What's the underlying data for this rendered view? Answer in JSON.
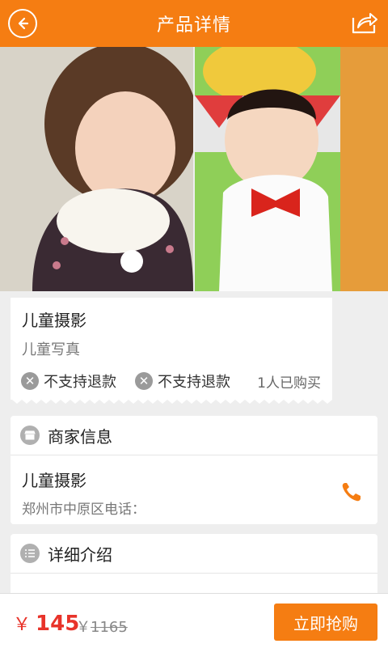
{
  "header": {
    "title": "产品详情"
  },
  "product": {
    "name": "儿童摄影",
    "subtitle": "儿童写真",
    "badges": [
      {
        "text": "不支持退款"
      },
      {
        "text": "不支持退款"
      }
    ],
    "bought_text": "1人已购买"
  },
  "merchant": {
    "section_title": "商家信息",
    "name": "儿童摄影",
    "address": "郑州市中原区电话："
  },
  "detail": {
    "section_title": "详细介绍"
  },
  "footer": {
    "currency": "￥",
    "price": "145",
    "orig_currency": "￥",
    "orig_price": "1165",
    "buy_label": "立即抢购"
  },
  "colors": {
    "accent": "#f57d12",
    "price": "#e8332a"
  }
}
